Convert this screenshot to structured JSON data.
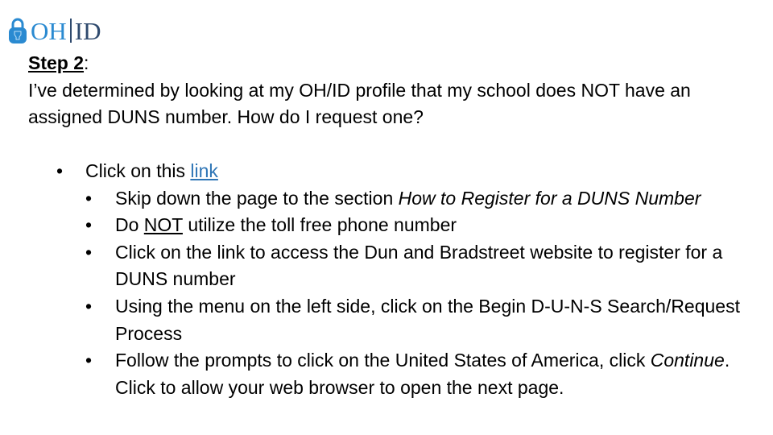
{
  "logo": {
    "icon": "lock-icon",
    "text_left": "OH",
    "text_right": "ID",
    "colors": {
      "oh": "#2a8ad1",
      "id": "#2f4a6e",
      "lock": "#2a8ad1"
    }
  },
  "heading": {
    "step_label": "Step 2",
    "step_suffix": ":",
    "question": "I’ve determined by looking at my OH/ID profile that my school does NOT have an assigned DUNS number. How do I request one?"
  },
  "bullets": {
    "main": {
      "prefix": "Click on this ",
      "link_text": "link",
      "link_color": "#2e75b6"
    },
    "sub": [
      {
        "text": "Skip down the page to the section ",
        "italic": "How to Register for a DUNS Number"
      },
      {
        "prefix": "Do ",
        "underlined": "NOT",
        "suffix": " utilize the toll free phone number"
      },
      {
        "text": "Click on the link to access the Dun and Bradstreet website to register for a DUNS number"
      },
      {
        "text": "Using the menu on the left side, click on the Begin D-U-N-S Search/Request Process"
      },
      {
        "prefix": "Follow the prompts to click on the United States of America, click ",
        "italic": "Continue",
        "suffix": ". Click to allow your web browser to open the next page."
      }
    ]
  }
}
